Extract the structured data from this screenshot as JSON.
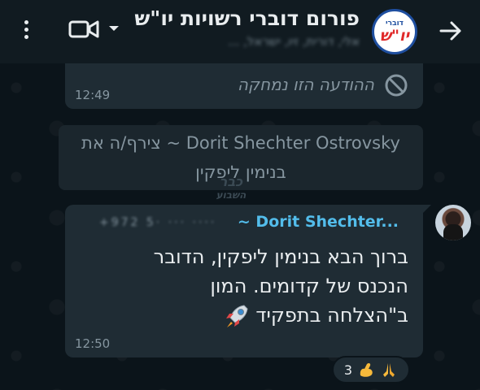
{
  "header": {
    "title": "פורום דוברי רשויות יו\"ש",
    "subtitle": "‏אלי, דורית, זיו, ישראל, ...",
    "avatar_line1": "דוברי",
    "avatar_line2": "יו\"ש",
    "back_icon": "arrow-right-icon",
    "video_icon": "video-camera-icon",
    "menu_icon": "more-vertical-icon"
  },
  "messages": {
    "deleted": {
      "text": "ההודעה הזו נמחקה",
      "time": "12:49"
    },
    "system": {
      "line1": "Dorit Shechter Ostrovsky ~ צירף/ה את",
      "line2": "בנימין ליפקין"
    },
    "watermark": {
      "line1": "כבר",
      "line2": "השבוע"
    },
    "incoming": {
      "sender": "~ Dorit Shechter...",
      "phone": "+972 5· ··· ····",
      "line1": "ברוך הבא בנימין ליפקין, הדובר",
      "line2": "הנכנס של קדומים. המון",
      "line3": "ב\"הצלחה בתפקיד",
      "time": "12:50",
      "reactions_count": "3"
    }
  },
  "colors": {
    "background": "#0b141a",
    "bubble": "#1f2c34",
    "accent_sender": "#53bdeb",
    "meta_text": "#8696a0"
  }
}
